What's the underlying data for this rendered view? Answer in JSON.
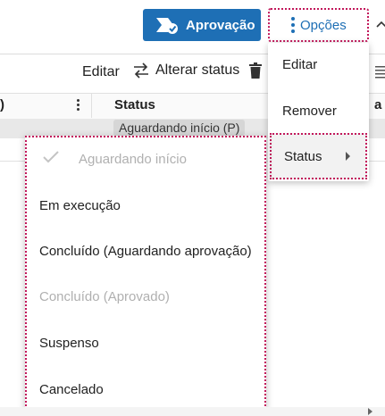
{
  "header": {
    "approval_button": "Aprovação",
    "options_button": "Opções"
  },
  "toolbar": {
    "edit_label": "Editar",
    "change_status_label": "Alterar status"
  },
  "table": {
    "partial_header": ")",
    "status_header": "Status",
    "partial_next_header": "a",
    "row_status": "Aguardando início (P)"
  },
  "options_menu": {
    "items": [
      "Editar",
      "Remover",
      "Status"
    ]
  },
  "status_menu": {
    "items": [
      {
        "label": "Aguardando início",
        "checked": true,
        "disabled": true
      },
      {
        "label": "Em execução",
        "checked": false,
        "disabled": false
      },
      {
        "label": "Concluído (Aguardando aprovação)",
        "checked": false,
        "disabled": false
      },
      {
        "label": "Concluído (Aprovado)",
        "checked": false,
        "disabled": true
      },
      {
        "label": "Suspenso",
        "checked": false,
        "disabled": false
      },
      {
        "label": "Cancelado",
        "checked": false,
        "disabled": false
      }
    ]
  },
  "icons": {
    "approval": "approval-stamp-icon",
    "options": "kebab-menu-icon",
    "change_status": "swap-arrows-icon",
    "delete": "trash-icon",
    "submenu": "caret-right-icon",
    "checked": "check-icon"
  },
  "colors": {
    "primary": "#1e6fb5",
    "highlight_outline": "#c2185b",
    "disabled_text": "#b0b0b0"
  }
}
